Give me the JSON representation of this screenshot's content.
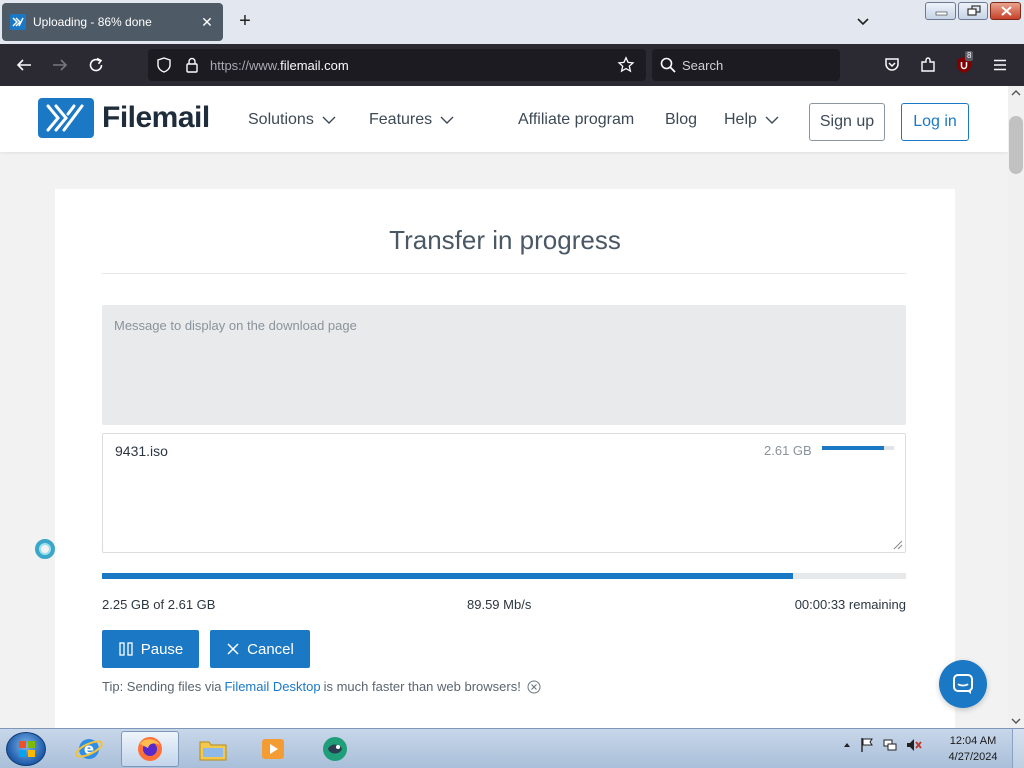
{
  "browser": {
    "tab_title": "Uploading - 86% done",
    "url_prefix": "https://www.",
    "url_domain": "filemail.com",
    "search_placeholder": "Search",
    "extension_badge": "8"
  },
  "site": {
    "logo_text": "Filemail",
    "nav": {
      "solutions": "Solutions",
      "features": "Features",
      "affiliate": "Affiliate program",
      "blog": "Blog",
      "help": "Help"
    },
    "signup_label": "Sign up",
    "login_label": "Log in",
    "brand_color": "#1b78c5"
  },
  "transfer": {
    "title": "Transfer in progress",
    "message_placeholder": "Message to display on the download page",
    "file": {
      "name": "9431.iso",
      "size": "2.61 GB",
      "progress": 0.86
    },
    "progress": 0.86,
    "transferred": "2.25 GB of 2.61 GB",
    "speed": "89.59 Mb/s",
    "remaining": "00:00:33 remaining",
    "pause_label": "Pause",
    "cancel_label": "Cancel",
    "tip_prefix": "Tip: Sending files via",
    "tip_link": "Filemail Desktop",
    "tip_suffix": "is much faster than web browsers!"
  },
  "taskbar": {
    "time": "12:04 AM",
    "date": "4/27/2024",
    "apps": [
      "internet-explorer",
      "firefox",
      "file-explorer",
      "media-player",
      "chat-app"
    ]
  }
}
